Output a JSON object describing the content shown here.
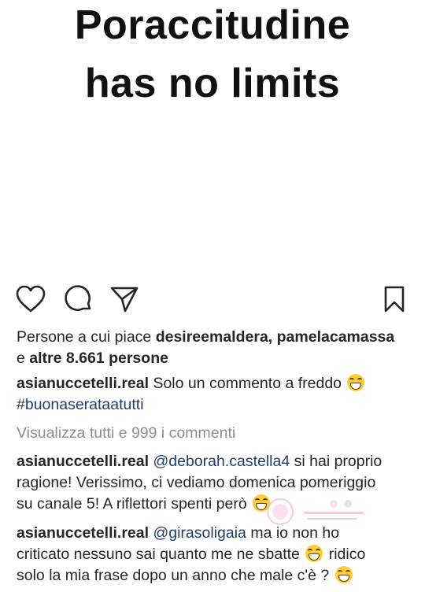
{
  "post_image": {
    "line1": "Poraccitudine",
    "line2": "has no limits"
  },
  "actions": {
    "like_icon": "heart-icon",
    "comment_icon": "comment-icon",
    "share_icon": "paper-plane-icon",
    "save_icon": "bookmark-icon"
  },
  "likes": {
    "prefix": "Persone a cui piace ",
    "user1": "desireemaldera",
    "sep": ", ",
    "user2": "pamelacamassa",
    "conj": "e ",
    "others": "altre 8.661 persone"
  },
  "caption": {
    "username": "asianuccetelli.real",
    "text": "Solo un commento a freddo",
    "hashtag": "#buonaserataatutti"
  },
  "view_all_comments": "Visualizza tutti e 999 i commenti",
  "comments": [
    {
      "username": "asianuccetelli.real",
      "mention": "@deborah.castella4",
      "line1_rest": "si hai proprio",
      "line2": "ragione! Verissimo, ci vediamo domenica pomeriggio",
      "line3": "su canale 5! A riflettori spenti però"
    },
    {
      "username": "asianuccetelli.real",
      "mention": "@girasoligaia",
      "line1_rest": "ma io non ho",
      "line2": "criticato nessuno sai quanto me ne sbatte",
      "line2_end": "ridico",
      "line3": "solo la mia frase dopo un anno che male c'è ?"
    }
  ],
  "colors": {
    "text": "#262626",
    "mention": "#1f3f6b",
    "muted": "#8e8e8e",
    "emoji": "#ffcc33"
  }
}
